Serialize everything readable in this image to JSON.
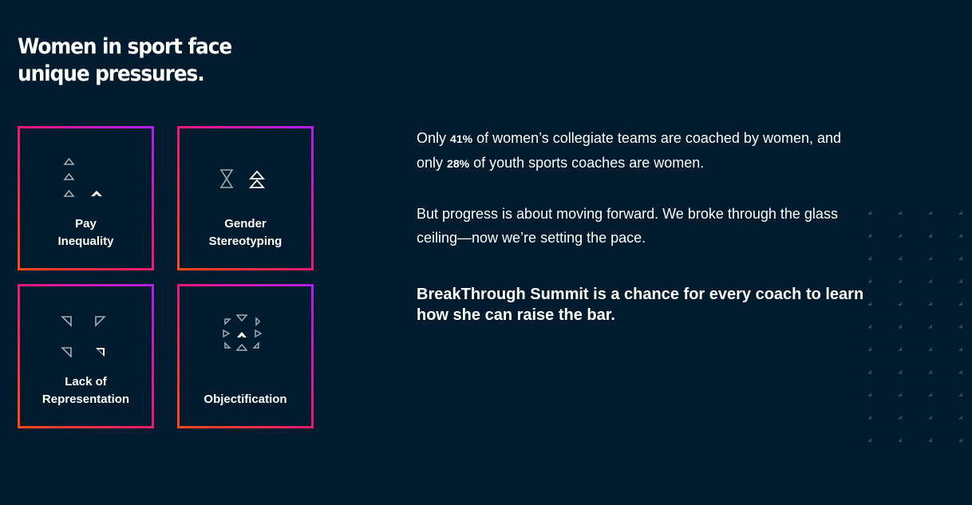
{
  "headline": {
    "line1": "Women in sport face",
    "line2": "unique pressures."
  },
  "cards": [
    {
      "line1": "Pay",
      "line2": "Inequality",
      "icon": "stacked-triangles-icon"
    },
    {
      "line1": "Gender",
      "line2": "Stereotyping",
      "icon": "hourglass-chevron-icon"
    },
    {
      "line1": "Lack of",
      "line2": "Representation",
      "icon": "corner-triangles-icon"
    },
    {
      "line1": "Objectification",
      "line2": "",
      "icon": "triangle-ring-icon"
    }
  ],
  "body": {
    "p1_before": "Only",
    "p1_stat1": "41%",
    "p1_middle": "of women’s collegiate teams are coached by women, and only",
    "p1_stat2": "28%",
    "p1_after": "of youth sports coaches are women.",
    "p2": "But progress is about moving forward. We broke through the glass ceiling—now we’re setting the pace.",
    "p3": "BreakThrough Summit is a chance for every coach to learn how she can raise the bar."
  },
  "colors": {
    "background": "#001b2e",
    "gradient_start": "#ff4b12",
    "gradient_mid": "#f01672",
    "gradient_end": "#b11cf6",
    "icon_gray": "#a3aab1"
  }
}
